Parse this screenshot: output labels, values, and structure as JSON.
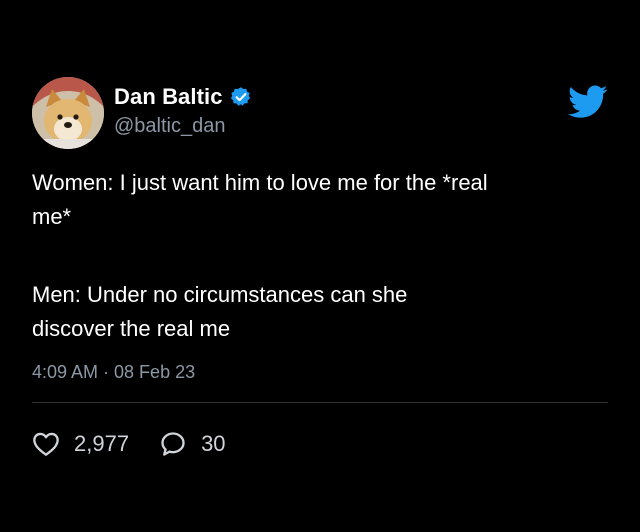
{
  "author": {
    "display_name": "Dan Baltic",
    "handle": "@baltic_dan",
    "verified": true,
    "avatar": "doge-avatar"
  },
  "tweet": {
    "text_lines": [
      "Women: I just want him to love me for the *real",
      "me*",
      "Men: Under no circumstances can she",
      "discover the real me"
    ],
    "timestamp": "4:09 AM · 08 Feb 23"
  },
  "stats": {
    "likes": "2,977",
    "replies": "30"
  },
  "icons": {
    "brand": "twitter-bird-icon",
    "verified": "verified-badge-icon",
    "like": "heart-icon",
    "reply": "reply-bubble-icon"
  },
  "colors": {
    "background": "#000000",
    "text": "#ffffff",
    "secondary_text": "#8b98a5",
    "brand_blue": "#1d9bf0"
  }
}
